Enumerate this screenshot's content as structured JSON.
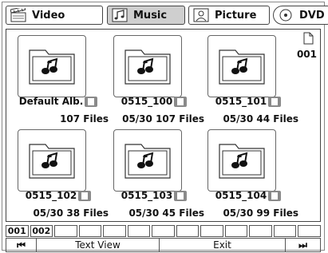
{
  "tabs": [
    {
      "label": "Video",
      "icon": "film-icon",
      "active": false
    },
    {
      "label": "Music",
      "icon": "music-note-icon",
      "active": true
    },
    {
      "label": "Picture",
      "icon": "picture-icon",
      "active": false
    },
    {
      "label": "DVD",
      "icon": "disc-icon",
      "active": false
    }
  ],
  "page": {
    "number": "001"
  },
  "folders": [
    {
      "name": "Default Alb.",
      "date": "",
      "files": "107 Files"
    },
    {
      "name": "0515_100",
      "date": "05/30",
      "files": "107 Files"
    },
    {
      "name": "0515_101",
      "date": "05/30",
      "files": "44  Files"
    },
    {
      "name": "0515_102",
      "date": "05/30",
      "files": "38  Files"
    },
    {
      "name": "0515_103",
      "date": "05/30",
      "files": "45 Files"
    },
    {
      "name": "0515_104",
      "date": "05/30",
      "files": "99 Files"
    }
  ],
  "page_strip": [
    "001",
    "002",
    "",
    "",
    "",
    "",
    "",
    "",
    "",
    "",
    "",
    "",
    ""
  ],
  "controls": {
    "prev": "⏮",
    "text_view": "Text View",
    "exit": "Exit",
    "next": "⏭"
  },
  "colors": {
    "active_tab": "#cfcfcf",
    "border": "#444444"
  }
}
